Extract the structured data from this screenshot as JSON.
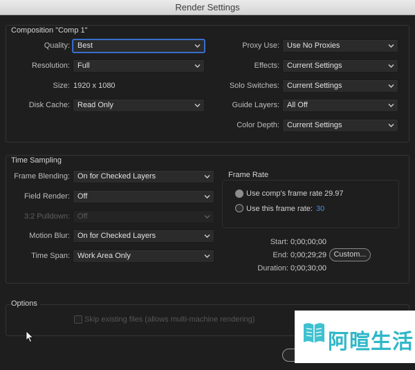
{
  "window": {
    "title": "Render Settings"
  },
  "composition": {
    "legend": "Composition \"Comp 1\"",
    "quality": {
      "label": "Quality:",
      "value": "Best"
    },
    "resolution": {
      "label": "Resolution:",
      "value": "Full"
    },
    "size": {
      "label": "Size:",
      "value": "1920 x 1080"
    },
    "disk_cache": {
      "label": "Disk Cache:",
      "value": "Read Only"
    },
    "proxy_use": {
      "label": "Proxy Use:",
      "value": "Use No Proxies"
    },
    "effects": {
      "label": "Effects:",
      "value": "Current Settings"
    },
    "solo_switches": {
      "label": "Solo Switches:",
      "value": "Current Settings"
    },
    "guide_layers": {
      "label": "Guide Layers:",
      "value": "All Off"
    },
    "color_depth": {
      "label": "Color Depth:",
      "value": "Current Settings"
    }
  },
  "time_sampling": {
    "legend": "Time Sampling",
    "frame_blending": {
      "label": "Frame Blending:",
      "value": "On for Checked Layers"
    },
    "field_render": {
      "label": "Field Render:",
      "value": "Off"
    },
    "pulldown": {
      "label": "3:2 Pulldown:",
      "value": "Off"
    },
    "motion_blur": {
      "label": "Motion Blur:",
      "value": "On for Checked Layers"
    },
    "time_span": {
      "label": "Time Span:",
      "value": "Work Area Only"
    },
    "frame_rate": {
      "legend": "Frame Rate",
      "use_comp_label": "Use comp's frame rate",
      "use_comp_value": "29.97",
      "use_this_label": "Use this frame rate:",
      "use_this_value": "30"
    },
    "start": {
      "label": "Start:",
      "value": "0;00;00;00"
    },
    "end": {
      "label": "End:",
      "value": "0;00;29;29"
    },
    "duration": {
      "label": "Duration:",
      "value": "0;00;30;00"
    },
    "custom_button": "Custom..."
  },
  "options": {
    "legend": "Options",
    "skip_existing_label": "Skip existing files (allows multi-machine rendering)"
  },
  "watermark": {
    "text": "阿暄生活"
  },
  "colors": {
    "accent": "#3f78d6",
    "frame_rate_value": "#4a90e2",
    "watermark": "#2fb7c8"
  }
}
